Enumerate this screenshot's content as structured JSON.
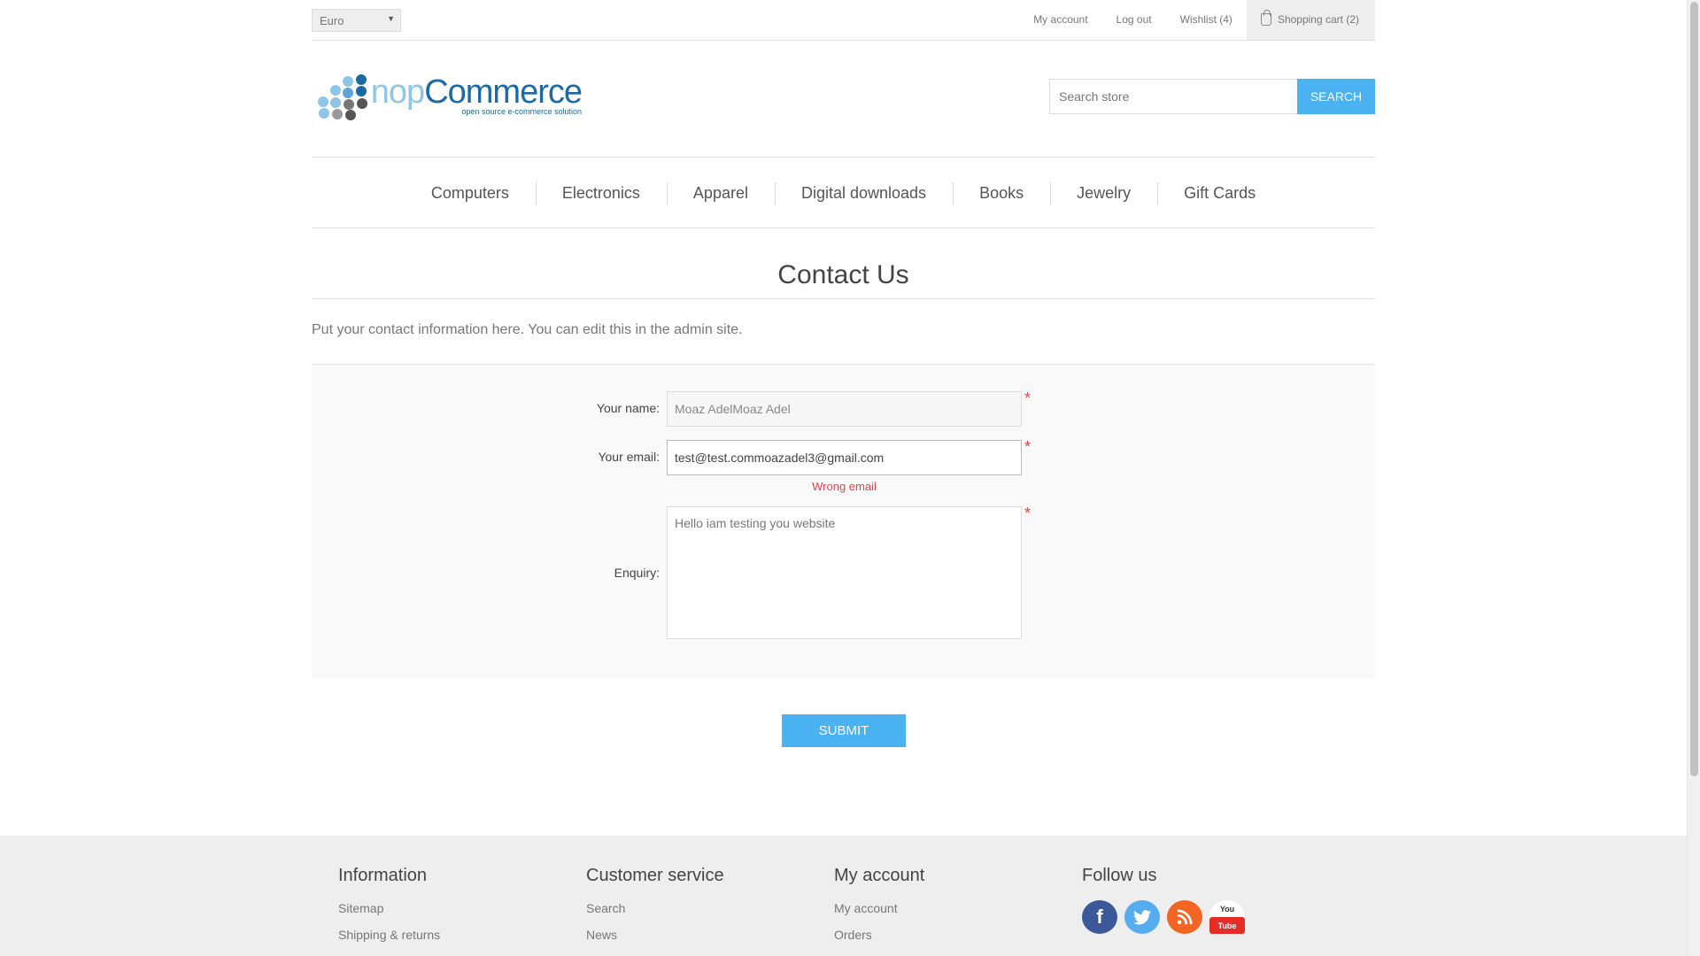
{
  "header": {
    "currency": "Euro",
    "links": {
      "my_account": "My account",
      "log_out": "Log out",
      "wishlist": "Wishlist (4)",
      "cart": "Shopping cart (2)"
    }
  },
  "logo": {
    "word_a": "nop",
    "word_b": "Commerce",
    "tagline": "open source e-commerce solution"
  },
  "search": {
    "placeholder": "Search store",
    "button": "Search"
  },
  "menu": [
    "Computers",
    "Electronics",
    "Apparel",
    "Digital downloads",
    "Books",
    "Jewelry",
    "Gift Cards"
  ],
  "page": {
    "title": "Contact Us",
    "intro": "Put your contact information here. You can edit this in the admin site."
  },
  "form": {
    "name_label": "Your name:",
    "name_value": "Moaz AdelMoaz Adel",
    "email_label": "Your email:",
    "email_value": "test@test.commoazadel3@gmail.com",
    "email_error": "Wrong email",
    "enquiry_label": "Enquiry:",
    "enquiry_value": "Hello iam testing you website",
    "required_mark": "*",
    "submit": "Submit"
  },
  "footer": {
    "columns": [
      {
        "title": "Information",
        "links": [
          "Sitemap",
          "Shipping & returns"
        ]
      },
      {
        "title": "Customer service",
        "links": [
          "Search",
          "News"
        ]
      },
      {
        "title": "My account",
        "links": [
          "My account",
          "Orders"
        ]
      }
    ],
    "follow_title": "Follow us",
    "social": {
      "facebook": "f",
      "youtube_a": "You",
      "youtube_b": "Tube"
    }
  },
  "colors": {
    "accent": "#4ab2f1",
    "error": "#e4434b",
    "logo_light": "#8fc5e8",
    "logo_dark": "#1b6aa6"
  }
}
